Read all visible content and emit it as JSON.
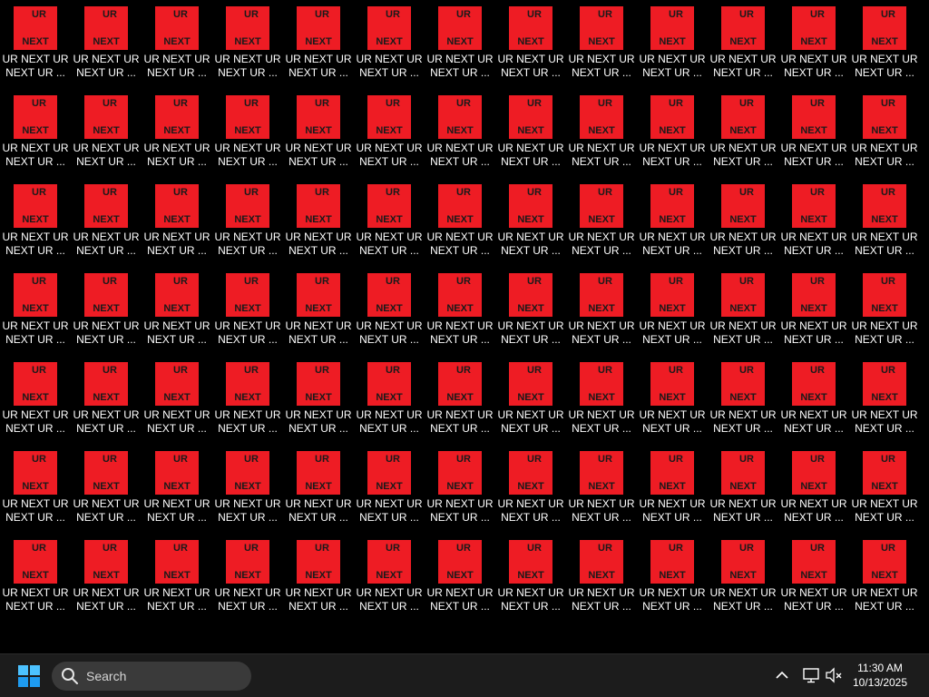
{
  "desktop": {
    "rows": 7,
    "columns": 13,
    "icon": {
      "thumb_top_text": "UR",
      "thumb_bottom_text": "NEXT",
      "label": "UR NEXT UR NEXT UR ...",
      "thumb_color": "#ee1c24"
    }
  },
  "taskbar": {
    "search_placeholder": "Search",
    "clock": {
      "time": "11:30 AM",
      "date": "10/13/2025"
    },
    "icons": {
      "start": "windows-logo-icon",
      "search": "search-icon",
      "overflow": "chevron-up-icon",
      "network": "network-monitor-icon",
      "volume": "speaker-muted-icon"
    },
    "accent_color": "#1e9bf0"
  }
}
